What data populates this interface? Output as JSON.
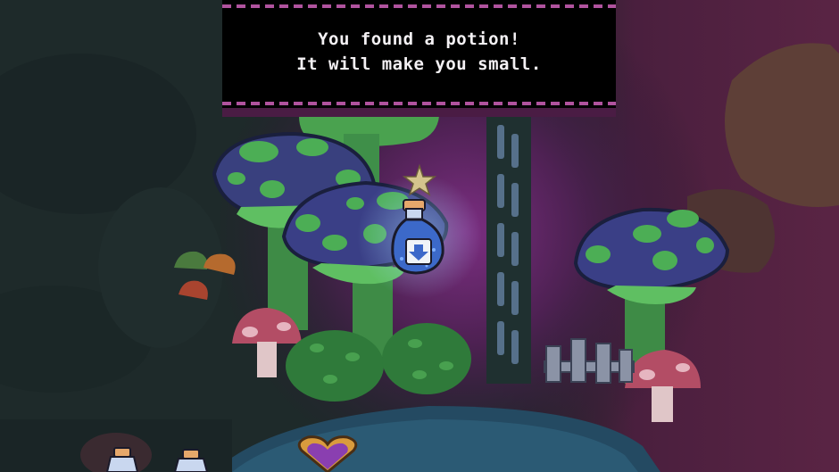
{
  "dialog": {
    "line1": "You found a potion!",
    "line2": "It will make you small."
  },
  "item": {
    "name": "shrink potion",
    "icon": "down-arrow-icon"
  },
  "hud": {
    "inventory_potions": 2,
    "heart": "heart-icon"
  },
  "colors": {
    "dialog_bg": "#000000",
    "dialog_border": "#b0539e",
    "potion_liquid": "#3c69c9",
    "mushroom_cap": "#3a3f86",
    "mushroom_spot": "#4cae55"
  }
}
